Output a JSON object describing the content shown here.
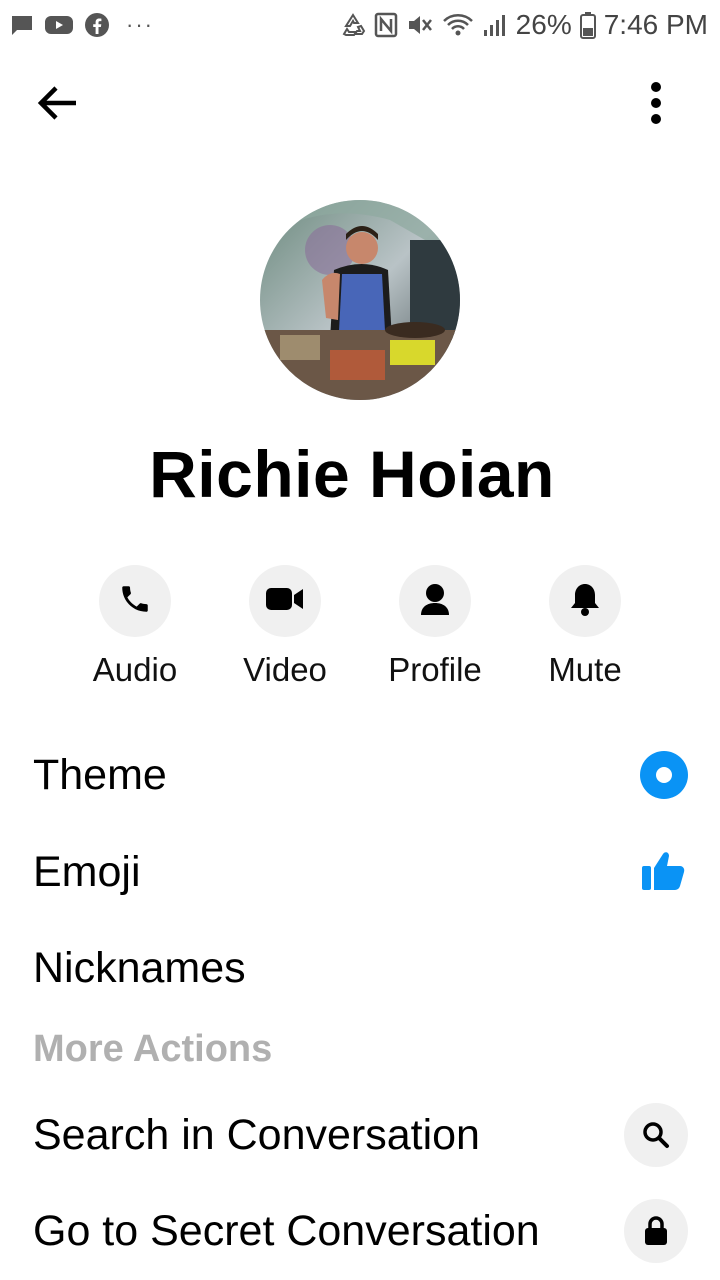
{
  "status_bar": {
    "left_icons": [
      "message-icon",
      "youtube-icon",
      "facebook-icon"
    ],
    "more": "···",
    "battery_percent": "26%",
    "time": "7:46 PM"
  },
  "header": {
    "back_icon": "arrow-left-icon",
    "more_icon": "more-vertical-icon"
  },
  "profile": {
    "name": "Richie Hoian"
  },
  "actions": [
    {
      "label": "Audio",
      "icon": "phone-icon"
    },
    {
      "label": "Video",
      "icon": "video-camera-icon"
    },
    {
      "label": "Profile",
      "icon": "person-icon"
    },
    {
      "label": "Mute",
      "icon": "bell-icon"
    }
  ],
  "settings": [
    {
      "label": "Theme",
      "icon": "theme-dot-icon"
    },
    {
      "label": "Emoji",
      "icon": "thumbs-up-icon"
    },
    {
      "label": "Nicknames"
    }
  ],
  "more_actions": {
    "heading": "More Actions",
    "items": [
      {
        "label": "Search in Conversation",
        "icon": "search-icon"
      },
      {
        "label": "Go to Secret Conversation",
        "icon": "lock-icon"
      }
    ]
  },
  "colors": {
    "accent": "#0a93f5",
    "icon_bg": "#f0f0f0",
    "section_heading": "#b0b0b0"
  }
}
